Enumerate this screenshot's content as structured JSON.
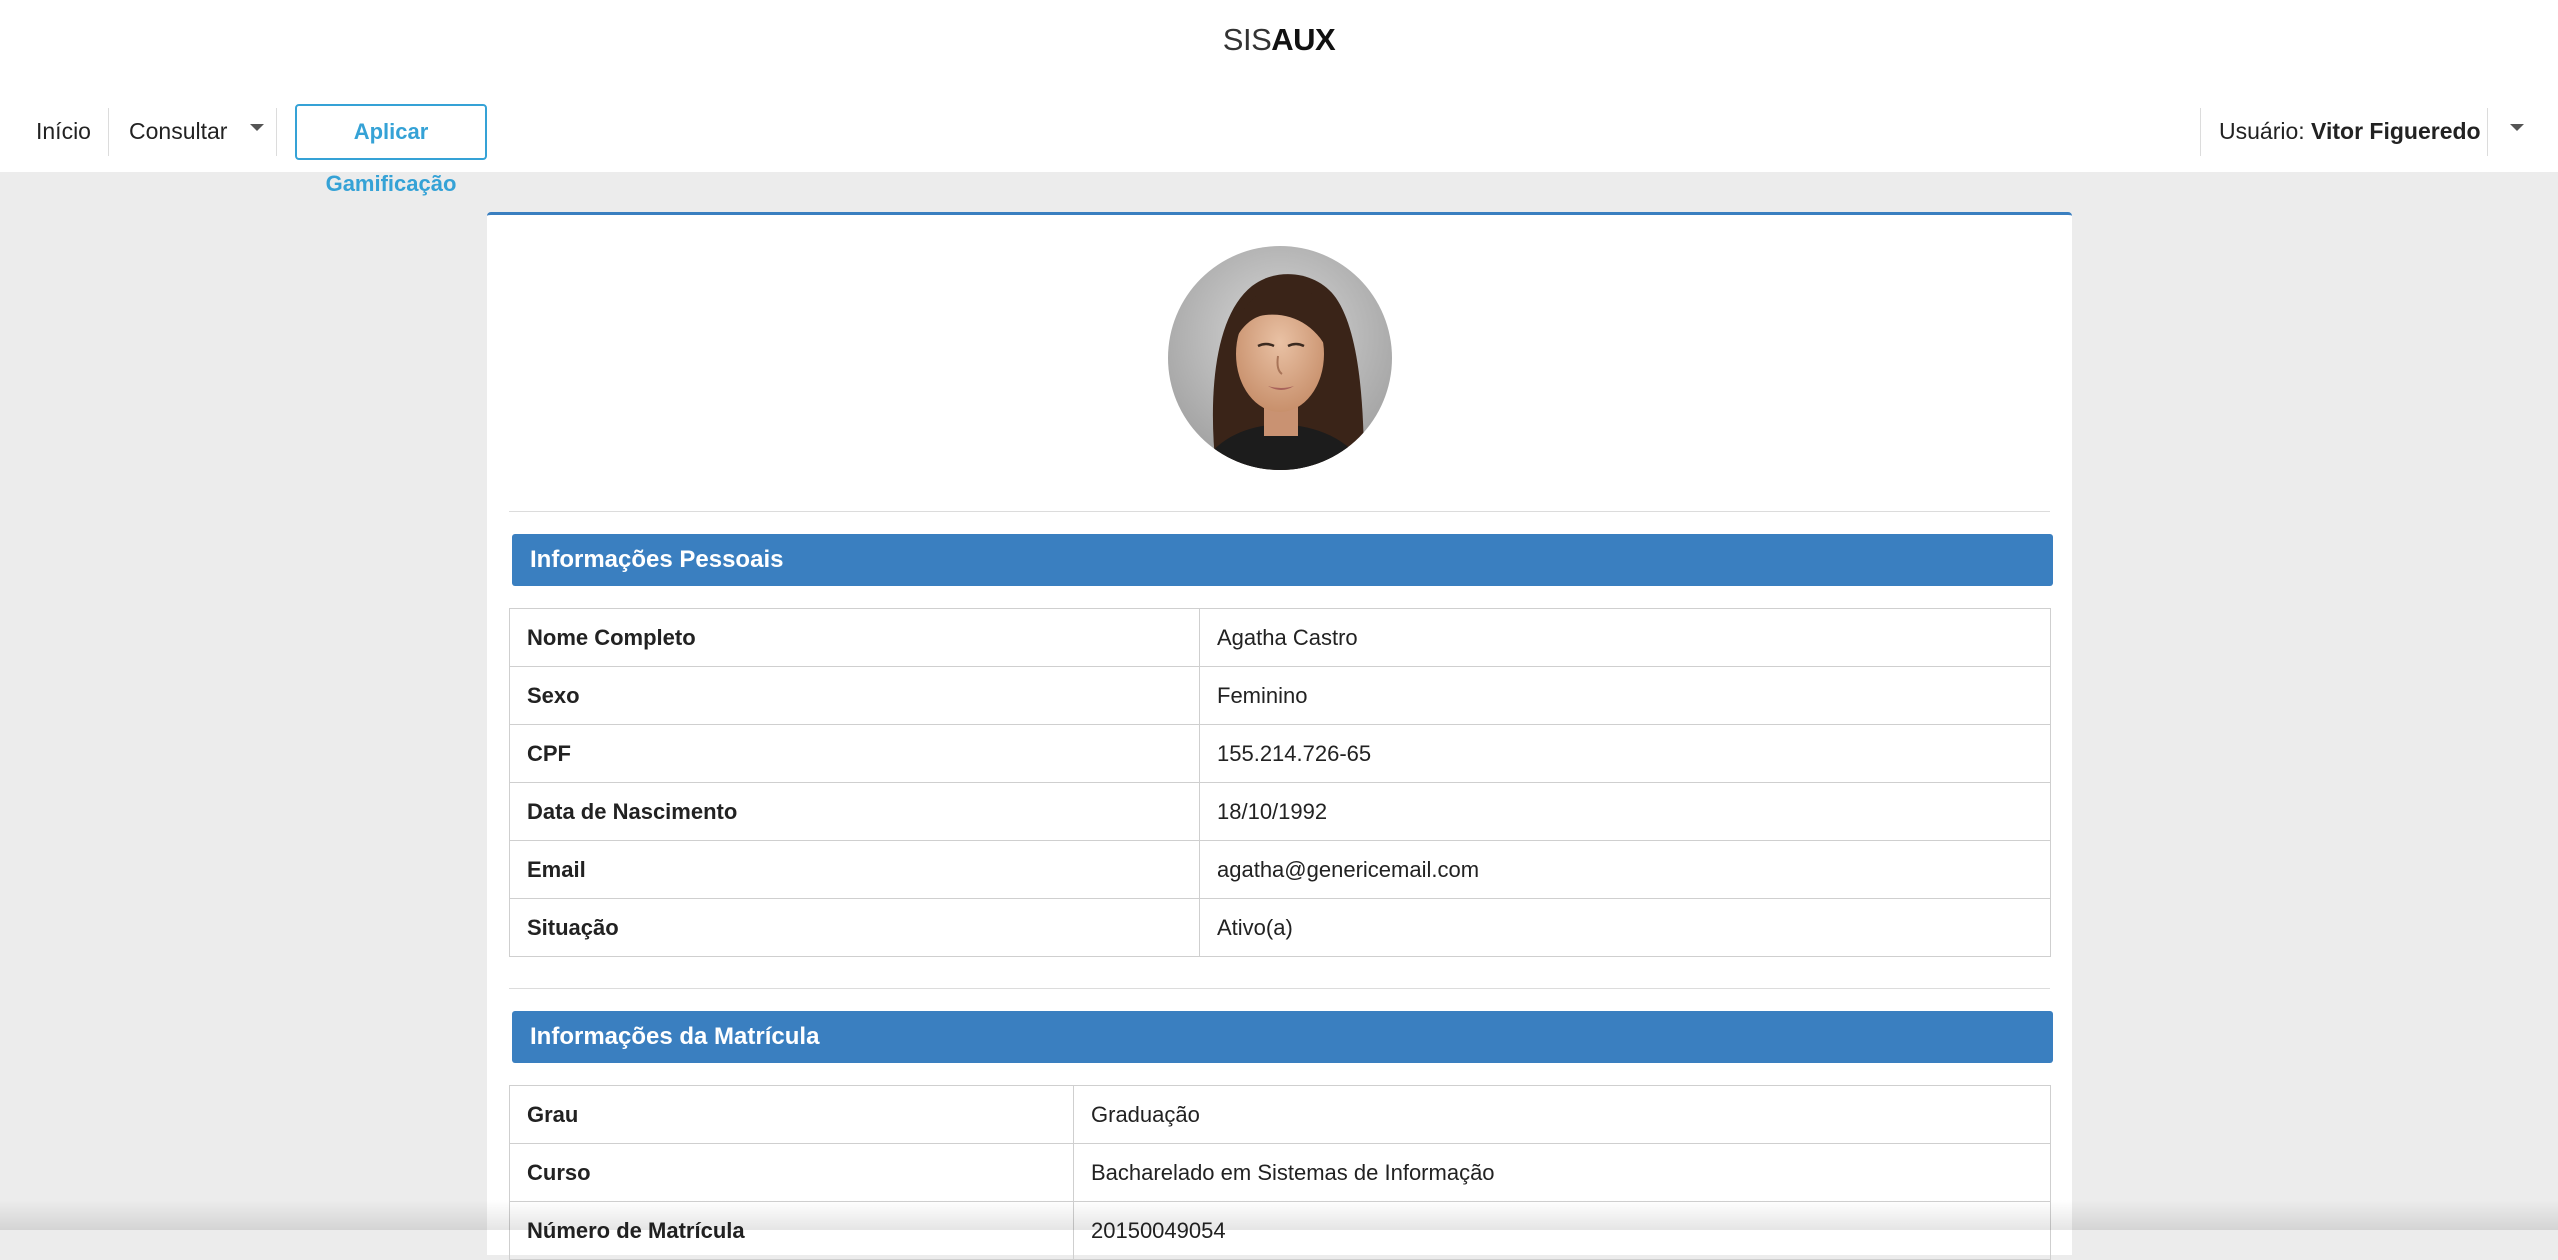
{
  "brand": {
    "light": "SIS",
    "bold": "AUX"
  },
  "nav": {
    "home_label": "Início",
    "consultar_label": "Consultar",
    "gamificacao_label": "Aplicar Gamificação",
    "user_prefix": "Usuário:",
    "user_name": "Vitor Figueredo"
  },
  "personal": {
    "title": "Informações Pessoais",
    "rows": [
      {
        "label": "Nome Completo",
        "value": "Agatha Castro"
      },
      {
        "label": "Sexo",
        "value": "Feminino"
      },
      {
        "label": "CPF",
        "value": "155.214.726-65"
      },
      {
        "label": "Data de Nascimento",
        "value": "18/10/1992"
      },
      {
        "label": "Email",
        "value": "agatha@genericemail.com"
      },
      {
        "label": "Situação",
        "value": "Ativo(a)"
      }
    ]
  },
  "enrollment": {
    "title": "Informações da Matrícula",
    "rows": [
      {
        "label": "Grau",
        "value": "Graduação"
      },
      {
        "label": "Curso",
        "value": "Bacharelado em Sistemas de Informação"
      },
      {
        "label": "Número de Matrícula",
        "value": "20150049054"
      }
    ]
  },
  "colors": {
    "accent": "#3a7fc0",
    "button_outline": "#35a2d6",
    "page_bg": "#ececec"
  }
}
